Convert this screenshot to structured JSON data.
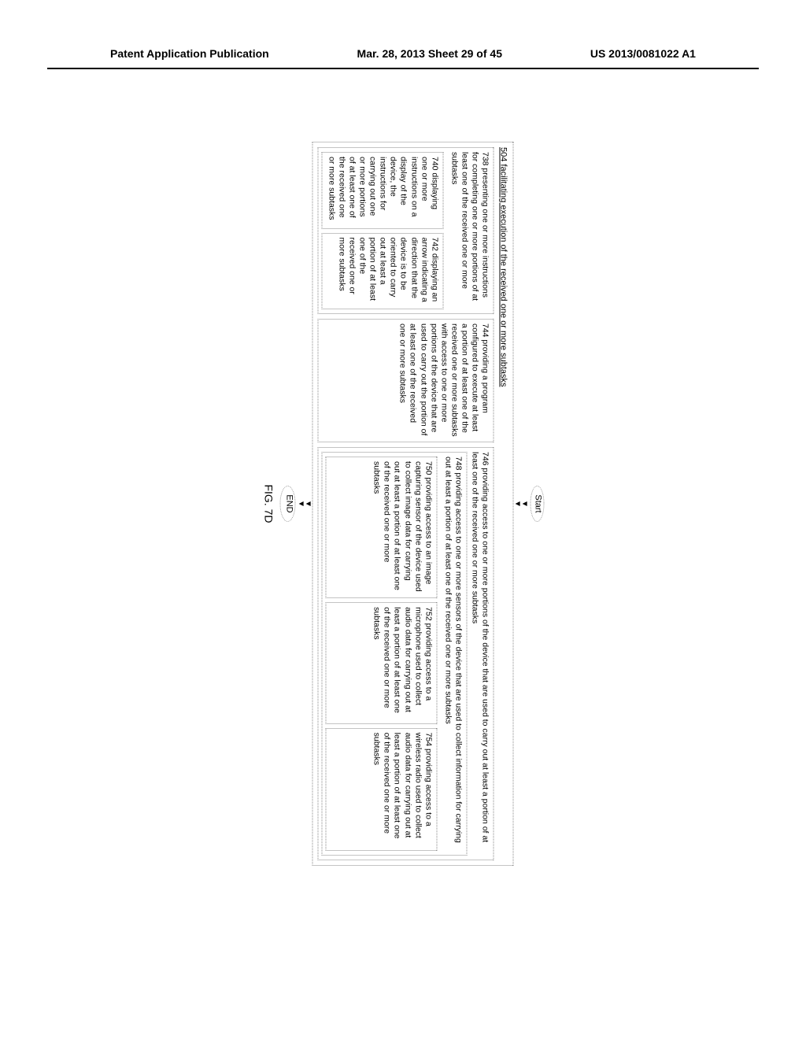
{
  "header": {
    "left": "Patent Application Publication",
    "center": "Mar. 28, 2013  Sheet 29 of 45",
    "right": "US 2013/0081022 A1"
  },
  "flow": {
    "start": "Start",
    "end": "END",
    "fig": "FIG. 7D"
  },
  "b504": "504 facilitating execution of the received one or more subtasks",
  "b738": "738 presenting one or more instructions for completing one or more portions of at least one of the received one or more subtasks",
  "b740": "740 displaying one or more instructions on a display of the device, the instructions for carrying out one or more portions of at least one of the received one or more subtasks",
  "b742": "742 displaying an arrow indicating a direction that the device is to be oriented to carry out at least a portion of at least one of the received one or more subtasks",
  "b744": "744 providing a program configured to execute at least a portion of at least one of the received one or more subtasks with access to one or more portions of the device that are used to carry out the portion of at least one of the received one or more subtasks",
  "b746": "746 providing access to one or more portions of the device that are used to carry out at least a portion of at least one of the received one or more subtasks",
  "b748": "748 providing access to one or more sensors of the device that are used to collect information for carrying out at least a portion of at least one of the received one or more subtasks",
  "b750": "750 providing access to an image capturing sensor of the device used to collect image data for carrying out at least a portion of at least one of the received one or more subtasks",
  "b752": "752 providing access to a microphone used to collect audio data for carrying out at least a portion of at least one of the received one or more subtasks",
  "b754": "754 providing access to a wireless radio used to collect audio data for carrying out at least a portion of at least one of the received one or more subtasks"
}
